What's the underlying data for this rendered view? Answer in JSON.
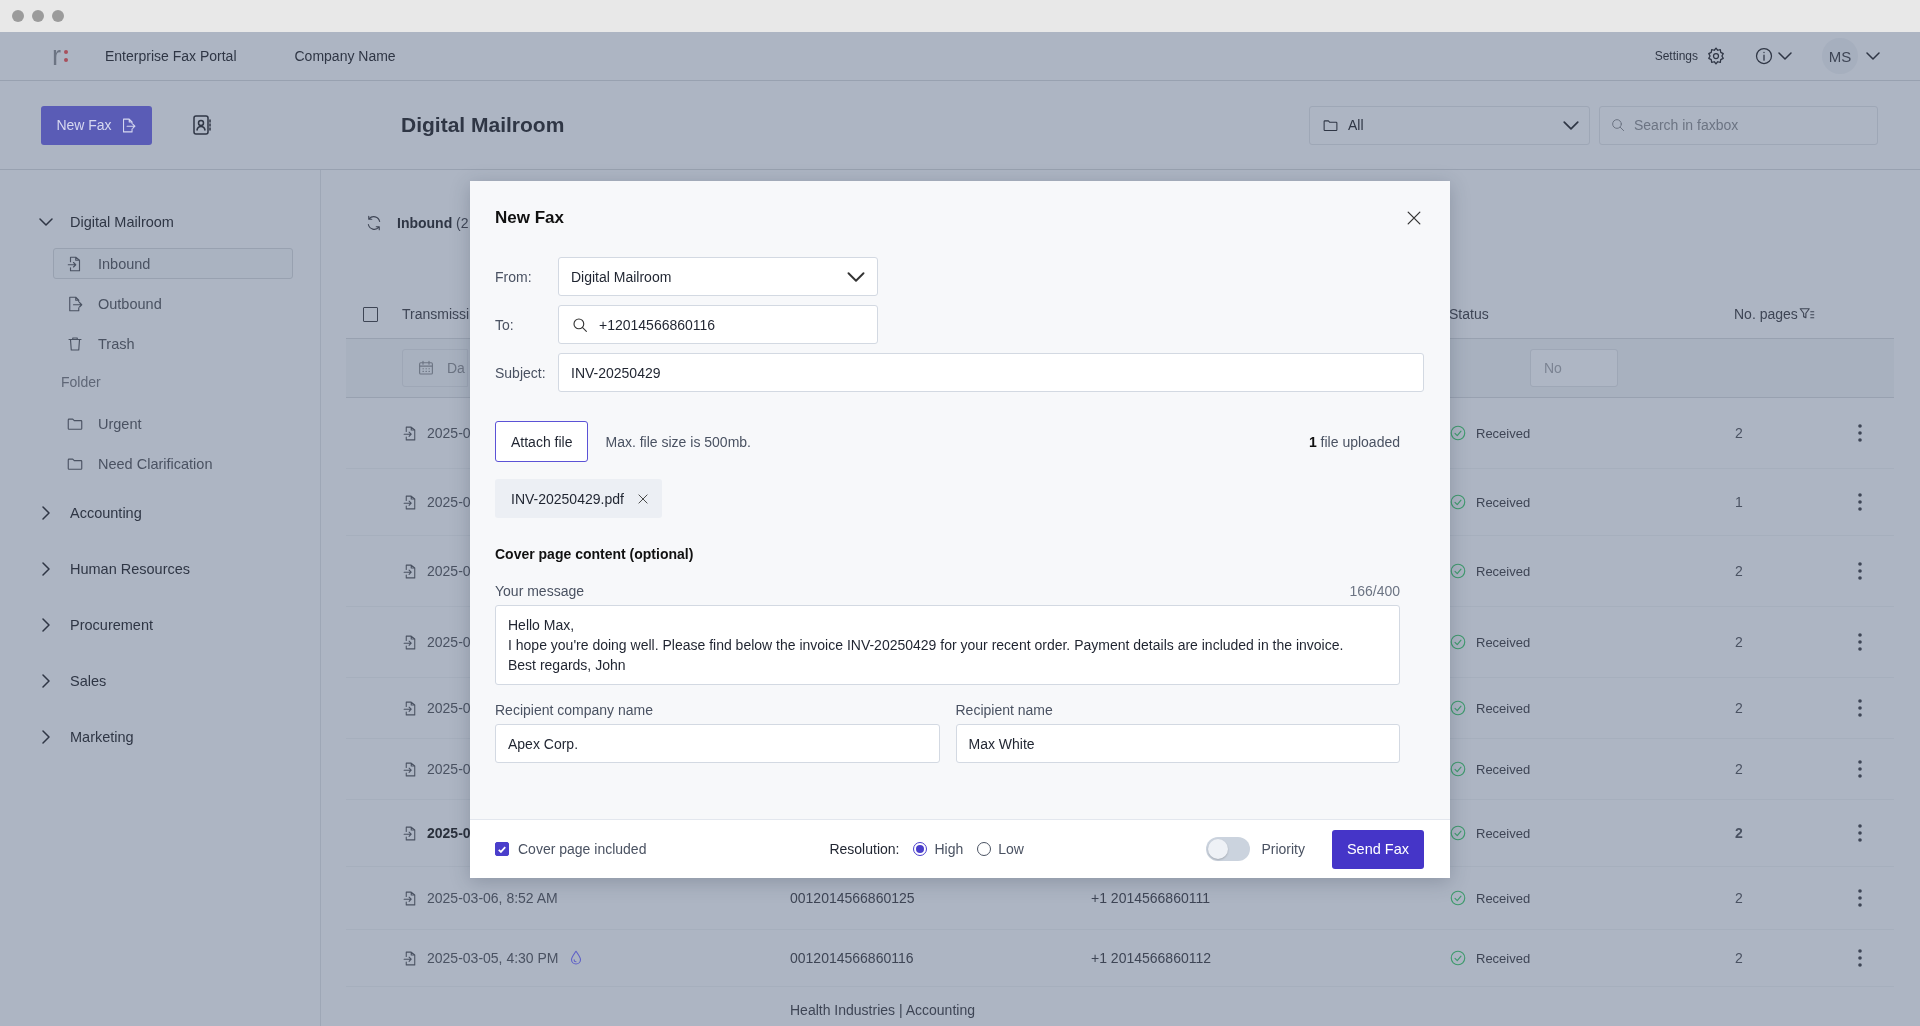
{
  "header": {
    "logo": "r",
    "product": "Enterprise Fax Portal",
    "company": "Company Name",
    "settings": "Settings",
    "user_initials": "MS"
  },
  "toolbar": {
    "new_fax": "New Fax",
    "title": "Digital Mailroom",
    "folder_filter": {
      "value": "All"
    },
    "search": {
      "placeholder": "Search in faxbox"
    }
  },
  "sidebar": {
    "groups": [
      {
        "label": "Digital Mailroom",
        "expanded": true,
        "children": [
          {
            "kind": "inbound",
            "label": "Inbound",
            "selected": true
          },
          {
            "kind": "outbound",
            "label": "Outbound",
            "selected": false
          },
          {
            "kind": "trash",
            "label": "Trash",
            "selected": false
          },
          {
            "kind": "heading",
            "label": "Folder"
          },
          {
            "kind": "folder",
            "label": "Urgent",
            "selected": false
          },
          {
            "kind": "folder",
            "label": "Need Clarification",
            "selected": false
          }
        ]
      },
      {
        "label": "Accounting",
        "expanded": false
      },
      {
        "label": "Human Resources",
        "expanded": false
      },
      {
        "label": "Procurement",
        "expanded": false
      },
      {
        "label": "Sales",
        "expanded": false
      },
      {
        "label": "Marketing",
        "expanded": false
      }
    ]
  },
  "inbox": {
    "title": "Inbound",
    "count": "(2",
    "select_all": {
      "checked": false
    },
    "columns": [
      "Transmissi",
      "Status",
      "No. pages"
    ],
    "date_filter": {
      "placeholder": "Da"
    },
    "pages_filter": {
      "placeholder": "No"
    },
    "rows": [
      {
        "date": "2025-0",
        "unread": false,
        "status": "Received",
        "pages": "2"
      },
      {
        "date": "2025-0",
        "unread": false,
        "status": "Received",
        "pages": "1"
      },
      {
        "date": "2025-0",
        "unread": false,
        "status": "Received",
        "pages": "2"
      },
      {
        "date": "2025-0",
        "unread": false,
        "status": "Received",
        "pages": "2"
      },
      {
        "date": "2025-0",
        "unread": false,
        "status": "Received",
        "pages": "2"
      },
      {
        "date": "2025-0",
        "unread": false,
        "status": "Received",
        "pages": "2"
      },
      {
        "date": "2025-0",
        "unread": true,
        "status": "Received",
        "pages": "2"
      },
      {
        "date": "2025-03-06, 8:52 AM",
        "unread": false,
        "flagged": false,
        "number": "0012014566860125",
        "sender": "+1 2014566860111",
        "status": "Received",
        "pages": "2"
      },
      {
        "date": "2025-03-05, 4:30 PM",
        "unread": false,
        "flagged": true,
        "number": "0012014566860116",
        "sender": "+1 2014566860112",
        "status": "Received",
        "pages": "2"
      },
      {
        "number": "Health Industries | Accounting"
      }
    ]
  },
  "dialog": {
    "title": "New Fax",
    "from": {
      "label": "From:",
      "value": "Digital Mailroom"
    },
    "to": {
      "label": "To:",
      "value": "+12014566860116"
    },
    "subject": {
      "label": "Subject:",
      "value": "INV-20250429"
    },
    "attach_button": "Attach file",
    "size_hint": "Max. file size is 500mb.",
    "uploaded": "**1** file uploaded",
    "files": [
      "INV-20250429.pdf"
    ],
    "cover_heading": "Cover page content (optional)",
    "message": {
      "label": "Your message",
      "counter": "166/400",
      "lines": [
        "Hello Max,",
        "I hope you're doing well. Please find below the invoice INV-20250429 for your recent order. Payment details are included in the invoice.",
        "Best regards, John"
      ]
    },
    "recipient_company": {
      "label": "Recipient company name",
      "value": "Apex Corp."
    },
    "recipient_name": {
      "label": "Recipient name",
      "value": "Max White"
    },
    "cover_included": {
      "label": "Cover page included",
      "checked": true
    },
    "resolution": {
      "label": "Resolution:",
      "options": [
        {
          "label": "High",
          "selected": true
        },
        {
          "label": "Low",
          "selected": false
        }
      ]
    },
    "priority": {
      "label": "Priority",
      "on": false
    },
    "send_button": "Send Fax"
  }
}
